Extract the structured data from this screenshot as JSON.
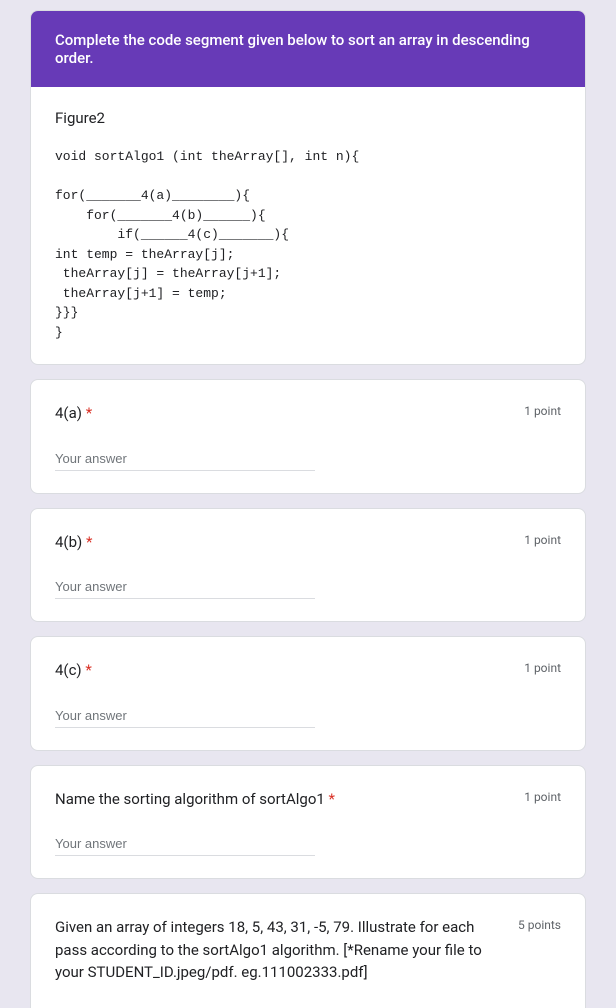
{
  "header": {
    "title": "Complete the code segment given below to sort an array in descending order."
  },
  "figure": {
    "label": "Figure2",
    "code": "void sortAlgo1 (int theArray[], int n){\n\nfor(_______4(a)________){\n    for(_______4(b)______){\n        if(______4(c)_______){\nint temp = theArray[j];\n theArray[j] = theArray[j+1];\n theArray[j+1] = temp;\n}}}\n}"
  },
  "questions": [
    {
      "label": "4(a)",
      "required": true,
      "points": "1 point",
      "placeholder": "Your answer",
      "type": "short"
    },
    {
      "label": "4(b)",
      "required": true,
      "points": "1 point",
      "placeholder": "Your answer",
      "type": "short"
    },
    {
      "label": "4(c)",
      "required": true,
      "points": "1 point",
      "placeholder": "Your answer",
      "type": "short"
    },
    {
      "label": "Name the sorting algorithm of sortAlgo1",
      "required": true,
      "points": "1 point",
      "placeholder": "Your answer",
      "type": "short"
    },
    {
      "label": "Given an array of integers 18, 5, 43, 31, -5, 79. Illustrate for each pass according to the sortAlgo1 algorithm. [*Rename your file to your STUDENT_ID.jpeg/pdf. eg.111002333.pdf]",
      "required": false,
      "points": "5 points",
      "placeholder": "",
      "type": "upload"
    }
  ],
  "required_marker": "*"
}
